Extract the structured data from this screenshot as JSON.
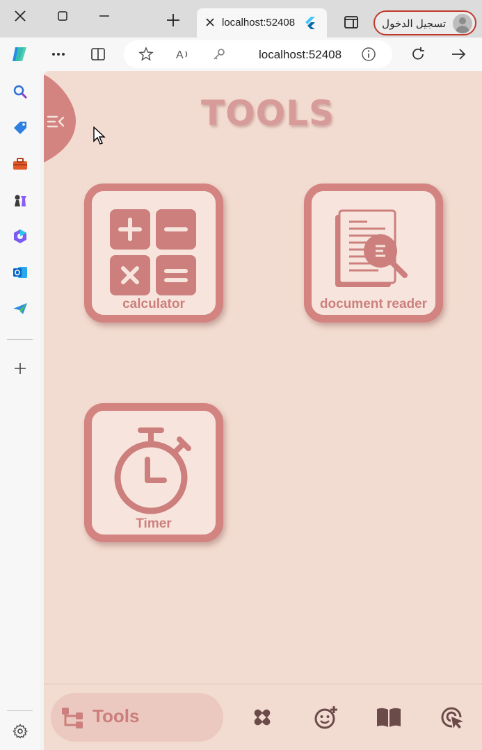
{
  "browser": {
    "tab": {
      "title": "localhost:52408"
    },
    "profile": {
      "label": "تسجيل الدخول"
    },
    "address": {
      "url": "localhost:52408"
    }
  },
  "app": {
    "title": "TOOLS",
    "tools": [
      {
        "label": "calculator",
        "icon": "calculator-icon"
      },
      {
        "label": "document reader",
        "icon": "document-reader-icon"
      },
      {
        "label": "Timer",
        "icon": "stopwatch-icon"
      }
    ],
    "bottom_nav": {
      "active_label": "Tools",
      "items": [
        "tools-icon",
        "bandage-icon",
        "emoji-add-icon",
        "book-icon",
        "cursor-click-icon"
      ]
    }
  },
  "colors": {
    "background": "#f2dbd0",
    "accent": "#d38380",
    "card_fill": "#f7e5dd"
  }
}
